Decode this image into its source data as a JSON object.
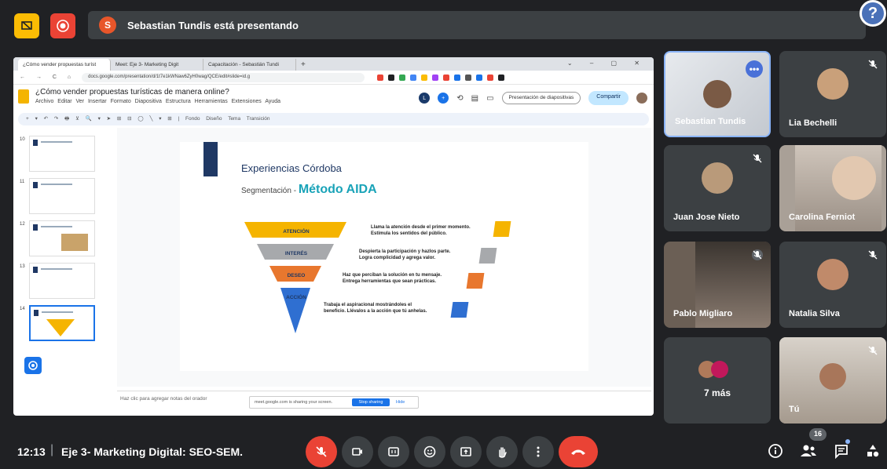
{
  "topbar": {
    "presenter_initial": "S",
    "presenting_text": "Sebastian Tundis está presentando",
    "help_symbol": "?"
  },
  "browser": {
    "tabs": [
      "¿Cómo vender propuestas turíst",
      "Meet: Eje 3- Marketing Digit",
      "Capacitación - Sebastián Tundi"
    ],
    "tab_plus": "+",
    "address": "docs.google.com/presentation/d/1t7e1kWNaw6ZyH0wag/QCE/edit#slide=id.g",
    "doc_title": "¿Cómo vender propuestas turísticas de manera online?",
    "menus": "Archivo Editar Ver Insertar Formato Diapositiva Estructura Herramientas Extensiones Ayuda",
    "present_label": "Presentación de diapositivas",
    "share_label": "Compartir",
    "toolbar_text": "Fondo  Diseño  Tema  Transición"
  },
  "filmstrip": {
    "numbers": [
      "10",
      "11",
      "12",
      "13",
      "14"
    ]
  },
  "slide": {
    "title": "Experiencias Córdoba",
    "subtitle_small": "Segmentación - ",
    "subtitle_big": "Método AIDA",
    "stages": [
      {
        "label": "ATENCIÓN",
        "desc1": "Llama la atención desde el primer momento.",
        "desc2": "Estimula los sentidos del público.",
        "color": "#f5b400"
      },
      {
        "label": "INTERÉS",
        "desc1": "Despierta la participación y hazlos parte.",
        "desc2": "Logra complicidad y agrega valor.",
        "color": "#a7a9ac"
      },
      {
        "label": "DESEO",
        "desc1": "Haz que perciban la solución en tu mensaje.",
        "desc2": "Entrega herramientas que sean prácticas.",
        "color": "#e8772e"
      },
      {
        "label": "ACCIÓN",
        "desc1": "Trabaja el aspiracional mostrándoles el",
        "desc2": "beneficio. Llévalos a la acción que tú anhelas.",
        "color": "#2f6fd1"
      }
    ]
  },
  "notes": {
    "placeholder": "Haz clic para agregar notas del orador",
    "sharing_text": "meet.google.com is sharing your screen.",
    "stop_label": "Stop sharing",
    "hide_label": "Hide"
  },
  "participants": [
    {
      "name": "Sebastian Tundis"
    },
    {
      "name": "Lia Bechelli"
    },
    {
      "name": "Juan Jose Nieto"
    },
    {
      "name": "Carolina Ferniot"
    },
    {
      "name": "Pablo Migliaro"
    },
    {
      "name": "Natalia Silva"
    },
    {
      "name": "7 más"
    },
    {
      "name": "Tú"
    }
  ],
  "more_dots": "•••",
  "bottom": {
    "time": "12:13",
    "separator": "|",
    "meeting_name": "Eje 3- Marketing Digital: SEO-SEM.",
    "participant_count": "16"
  },
  "colors": {
    "background": "#202124",
    "tile": "#3c4043",
    "red": "#ea4335",
    "accent_blue": "#4a71d8"
  }
}
